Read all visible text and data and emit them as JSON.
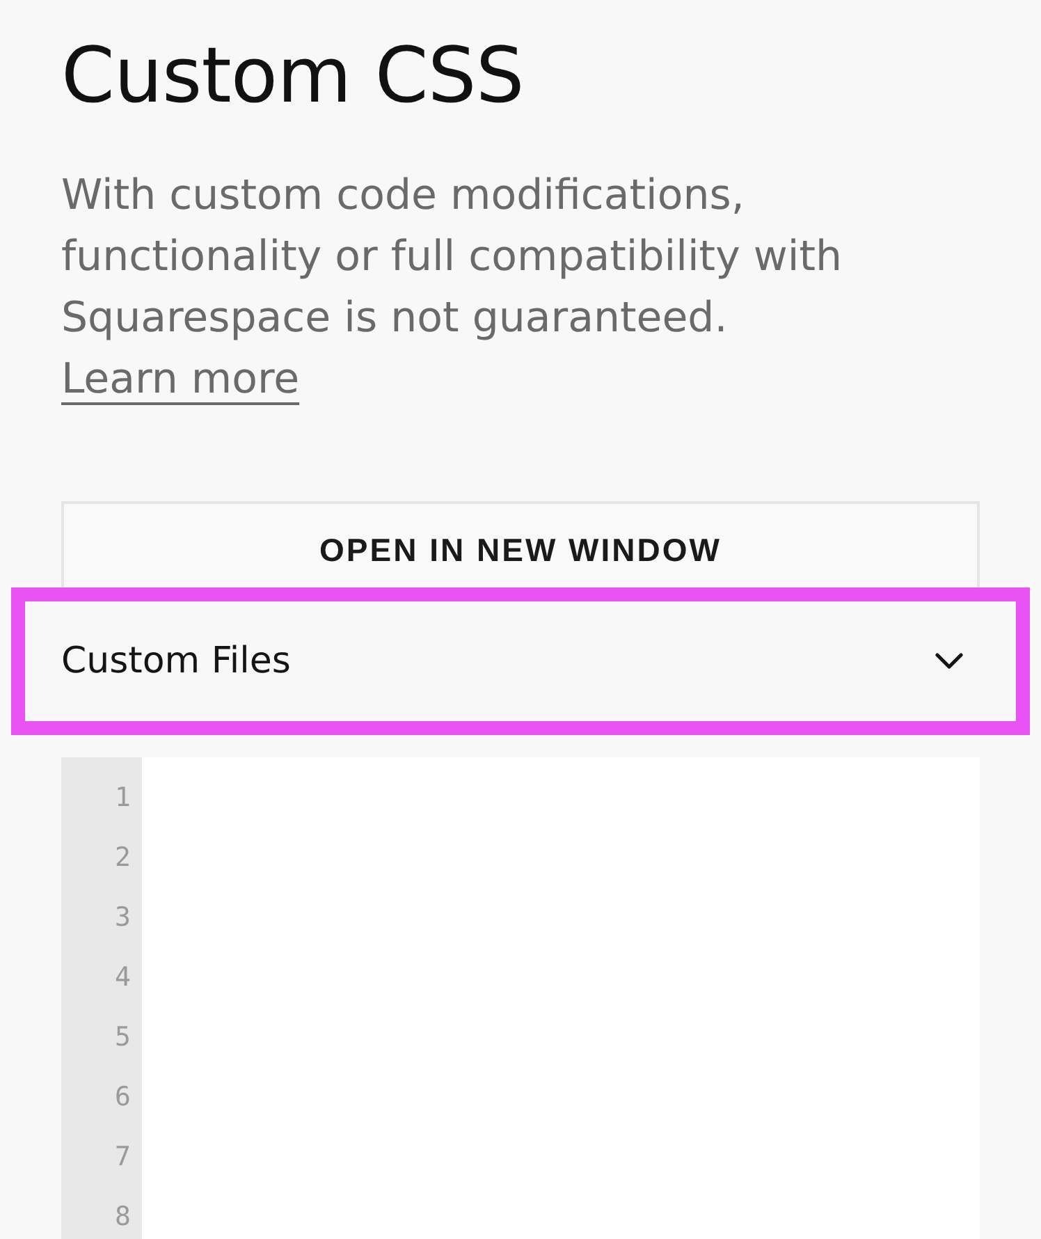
{
  "title": "Custom CSS",
  "notice": {
    "text": "With custom code modifications, functionality or full compatibility with Squarespace is not guaranteed.",
    "link": "Learn more"
  },
  "open_button": {
    "label": "OPEN IN NEW WINDOW"
  },
  "file_dropdown": {
    "label": "Custom Files",
    "expanded": false,
    "highlighted": true
  },
  "editor": {
    "line_numbers": [
      "1",
      "2",
      "3",
      "4",
      "5",
      "6",
      "7",
      "8"
    ]
  }
}
